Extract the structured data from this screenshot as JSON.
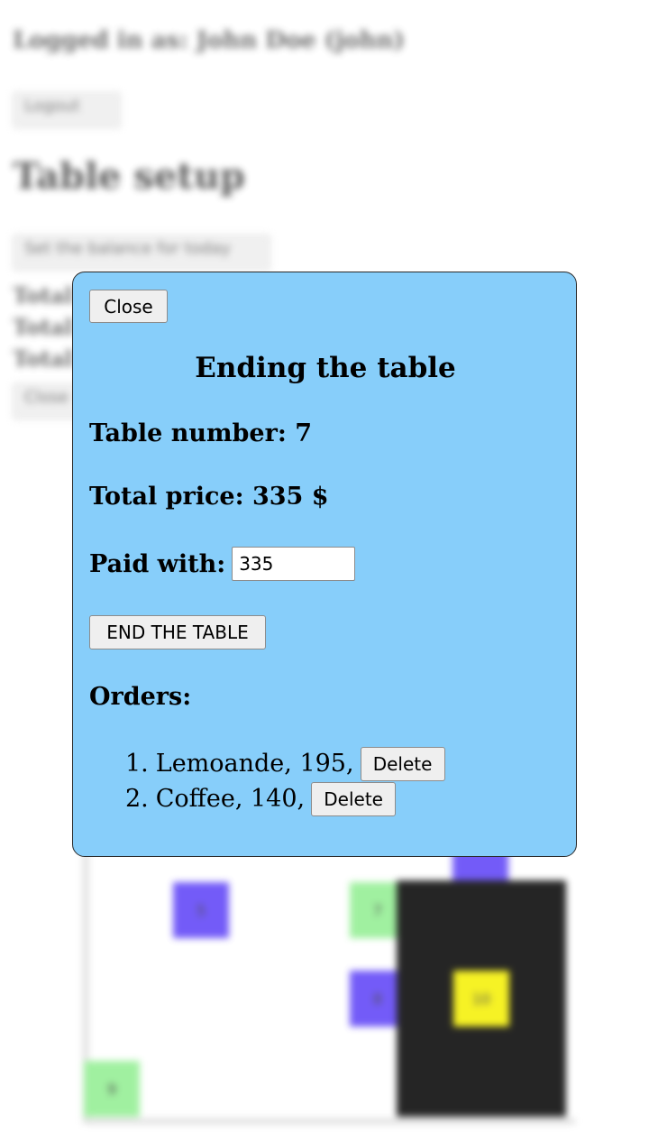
{
  "background": {
    "logged_in_text": "Logged in as: John Doe (john)",
    "logout_label": "Logout",
    "page_title": "Table setup",
    "balance_button_label": "Set the balance for today",
    "total_lines": [
      "Total",
      "Total",
      "Total"
    ],
    "close_label": "Close",
    "tiles": [
      {
        "label": "5",
        "color": "#5b3ff7"
      },
      {
        "label": "7",
        "color": "#90ee90"
      },
      {
        "label": "8",
        "color": "#5b3ff7"
      },
      {
        "label": "10",
        "color": "#f5f000"
      },
      {
        "label": "9",
        "color": "#90ee90"
      },
      {
        "label": "",
        "color": "#5b3ff7"
      }
    ]
  },
  "modal": {
    "close_label": "Close",
    "title": "Ending the table",
    "table_number_label": "Table number: 7",
    "total_price_label": "Total price: 335 $",
    "paid_with_label": "Paid with:",
    "paid_with_value": "335",
    "end_button_label": "END THE TABLE",
    "orders_heading": "Orders:",
    "orders": [
      {
        "num": "1.",
        "text": "Lemoande, 195,",
        "delete_label": "Delete"
      },
      {
        "num": "2.",
        "text": "Coffee, 140,",
        "delete_label": "Delete"
      }
    ],
    "background_color": "#87cefa"
  }
}
